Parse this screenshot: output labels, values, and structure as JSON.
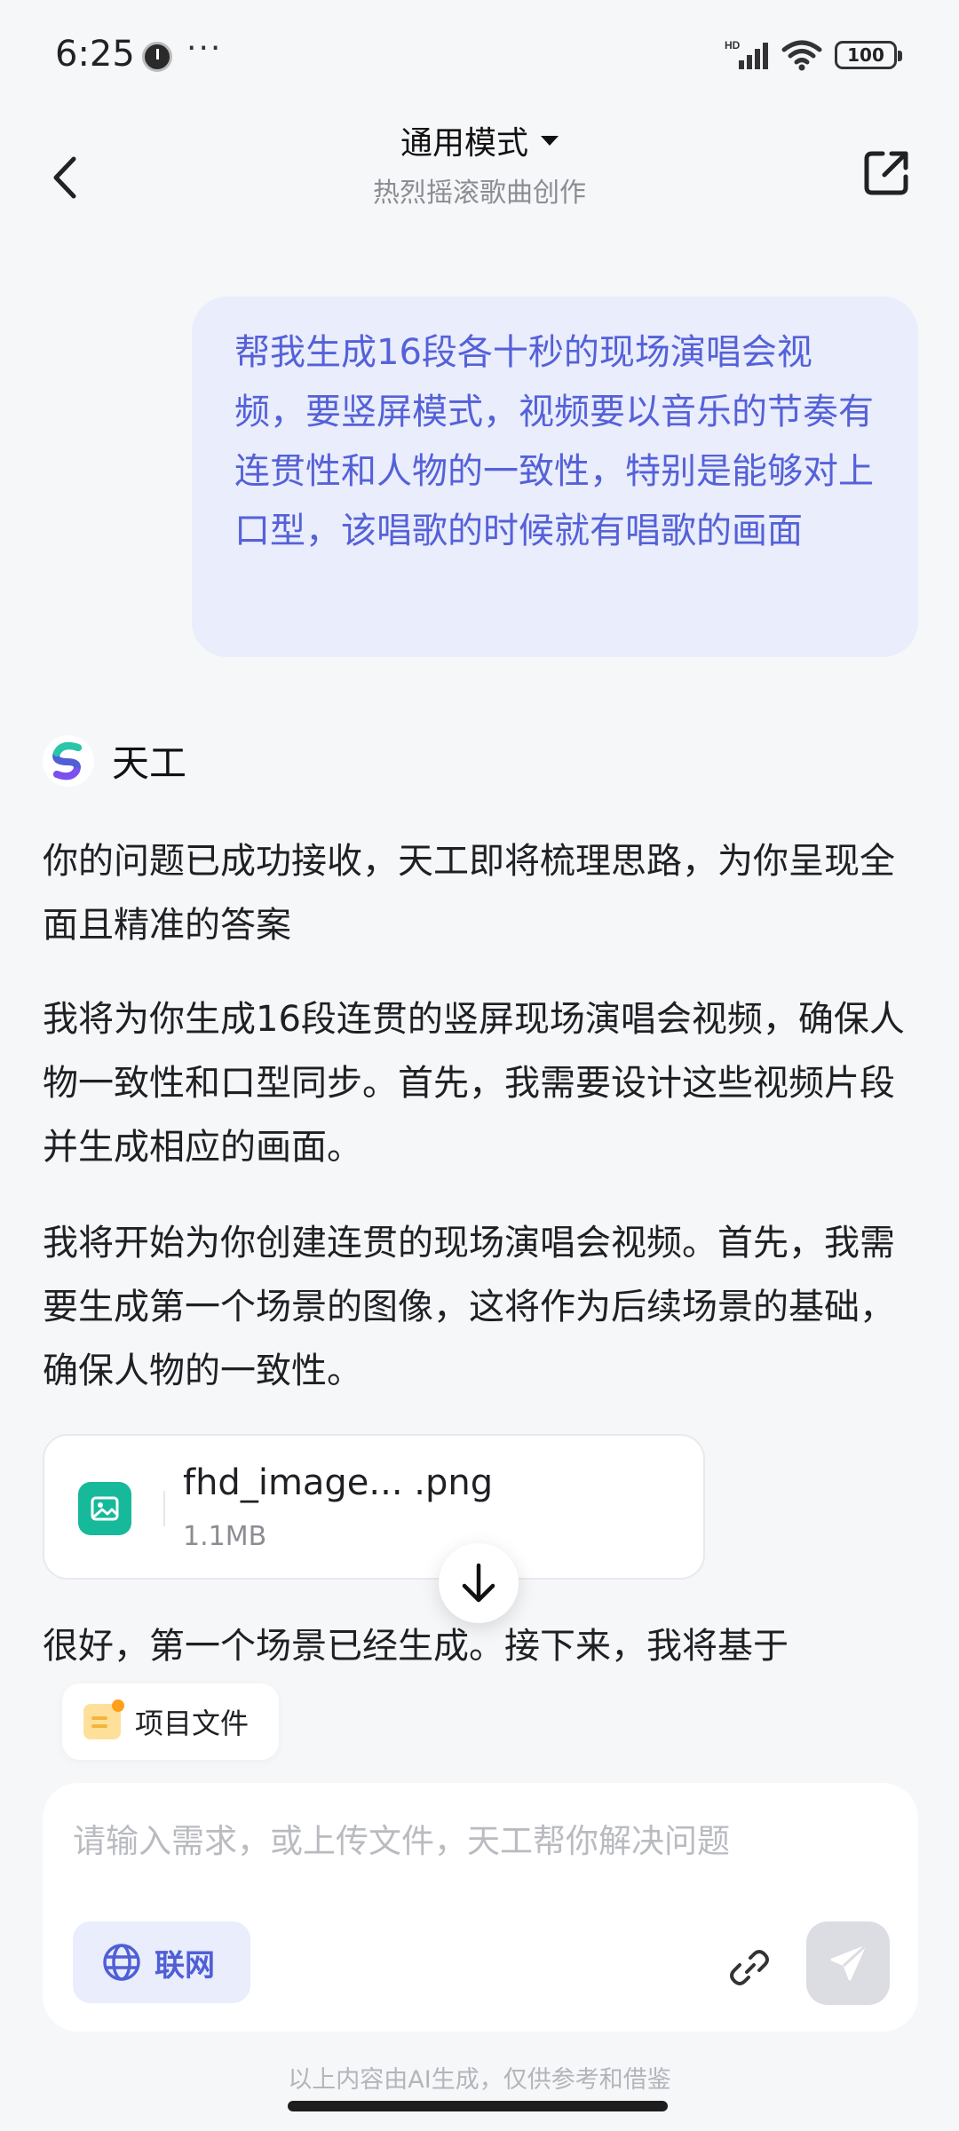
{
  "status_bar": {
    "time": "6:25",
    "more": "···",
    "battery": "100",
    "network_badge": "HD"
  },
  "header": {
    "mode_title": "通用模式",
    "subtitle": "热烈摇滚歌曲创作"
  },
  "user_message": "帮我生成16段各十秒的现场演唱会视频，要竖屏模式，视频要以音乐的节奏有连贯性和人物的一致性，特别是能够对上口型，该唱歌的时候就有唱歌的画面",
  "assistant": {
    "name": "天工",
    "paragraphs": [
      "你的问题已成功接收，天工即将梳理思路，为你呈现全面且精准的答案",
      "我将为你生成16段连贯的竖屏现场演唱会视频，确保人物一致性和口型同步。首先，我需要设计这些视频片段并生成相应的画面。",
      "我将开始为你创建连贯的现场演唱会视频。首先，我需要生成第一个场景的图像，这将作为后续场景的基础，确保人物的一致性。",
      "很好，第一个场景已经生成。接下来，我将基于"
    ],
    "file": {
      "name": "fhd_image... .png",
      "size": "1.1MB"
    }
  },
  "project_chip": "项目文件",
  "input": {
    "placeholder": "请输入需求，或上传文件，天工帮你解决问题",
    "value": "",
    "web_toggle": "联网"
  },
  "disclaimer": "以上内容由AI生成，仅供参考和借鉴",
  "colors": {
    "accent": "#4f5fd6",
    "user_bubble": "#e9edfc",
    "file_icon": "#16b99a",
    "background": "#f6f7f9"
  },
  "icons": [
    "clock-icon",
    "signal-icon",
    "wifi-icon",
    "battery-icon",
    "back-arrow-icon",
    "share-icon",
    "tiangong-logo-icon",
    "image-file-icon",
    "arrow-down-icon",
    "folder-icon",
    "globe-icon",
    "link-icon",
    "send-icon"
  ]
}
